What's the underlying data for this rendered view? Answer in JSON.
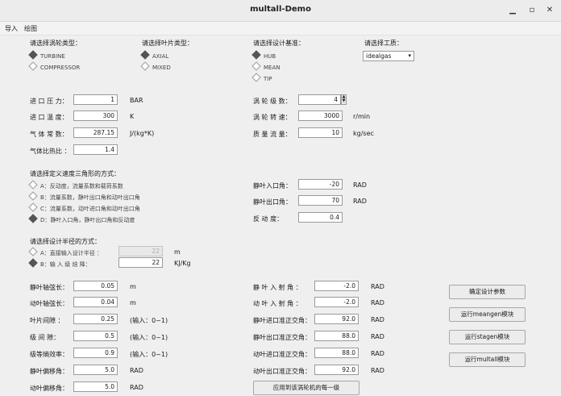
{
  "window": {
    "title": "multall-Demo",
    "minimize_icon": "minimize-icon",
    "maximize_icon": "maximize-icon",
    "close_icon": "close-icon"
  },
  "menu": {
    "import": "导入",
    "plot": "绘图"
  },
  "groups": {
    "turbine_type": {
      "label": "请选择涡轮类型：",
      "options": [
        "TURBINE",
        "COMPRESSOR"
      ],
      "selected": 0
    },
    "blade_type": {
      "label": "请选择叶片类型：",
      "options": [
        "AXIAL",
        "MIXED"
      ],
      "selected": 0
    },
    "design_basis": {
      "label": "请选择设计基准：",
      "options": [
        "HUB",
        "MEAN",
        "TIP"
      ],
      "selected": 0
    },
    "condition": {
      "label": "请选择工质：",
      "value": "idealgas"
    }
  },
  "params_left": [
    {
      "label": "进 口 压 力：",
      "value": "1",
      "unit": "BAR"
    },
    {
      "label": "进 口 温 度：",
      "value": "300",
      "unit": "K"
    },
    {
      "label": "气 体 常 数：",
      "value": "287.15",
      "unit": "J/(kg*K)"
    },
    {
      "label": "气体比热比 ：",
      "value": "1.4",
      "unit": ""
    }
  ],
  "params_right": [
    {
      "label": "涡 轮 级 数：",
      "value": "4",
      "unit": ""
    },
    {
      "label": "涡 轮 转 速：",
      "value": "3000",
      "unit": "r/min"
    },
    {
      "label": "质 量 流 量：",
      "value": "10",
      "unit": "kg/sec"
    }
  ],
  "velocity": {
    "label": "请选择定义速度三角形的方式：",
    "options": [
      "A：反动度，流量系数和载荷系数",
      "B：流量系数，静叶出口角和动叶出口角",
      "C：流量系数，动叶进口角和动叶出口角",
      "D：静叶入口角，静叶出口角和反动度"
    ],
    "selected": 3
  },
  "velocity_params": [
    {
      "label": "静叶入口角：",
      "value": "-20",
      "unit": "RAD"
    },
    {
      "label": "静叶出口角：",
      "value": "70",
      "unit": "RAD"
    },
    {
      "label": "反  动  度：",
      "value": "0.4",
      "unit": ""
    }
  ],
  "radius": {
    "label": "请选择设计半径的方式：",
    "options": [
      "A：直接输入设计半径 ：",
      "B：输  入  级  焓  降："
    ],
    "selected": 1,
    "values": [
      "22",
      "22"
    ],
    "units": [
      "m",
      "KJ/Kg"
    ]
  },
  "bottom_left": [
    {
      "label": "静叶轴弦长：",
      "value": "0.05",
      "unit": "m"
    },
    {
      "label": "动叶轴弦长：",
      "value": "0.04",
      "unit": "m"
    },
    {
      "label": "叶片间隙  ：",
      "value": "0.25",
      "unit": "(输入：0~1)"
    },
    {
      "label": "级  间  隙：",
      "value": "0.5",
      "unit": "(输入：0~1)"
    },
    {
      "label": "级等熵效率：",
      "value": "0.9",
      "unit": "(输入：0~1)"
    },
    {
      "label": "静叶偏移角：",
      "value": "5.0",
      "unit": "RAD"
    },
    {
      "label": "动叶偏移角：",
      "value": "5.0",
      "unit": "RAD"
    }
  ],
  "bottom_right": [
    {
      "label": "静 叶 入 射 角 ：",
      "value": "-2.0",
      "unit": "RAD"
    },
    {
      "label": "动 叶 入 射 角 ：",
      "value": "-2.0",
      "unit": "RAD"
    },
    {
      "label": "静叶进口准正交角：",
      "value": "92.0",
      "unit": "RAD"
    },
    {
      "label": "静叶出口准正交角：",
      "value": "88.0",
      "unit": "RAD"
    },
    {
      "label": "动叶进口准正交角：",
      "value": "88.0",
      "unit": "RAD"
    },
    {
      "label": "动叶出口准正交角：",
      "value": "92.0",
      "unit": "RAD"
    }
  ],
  "apply_button": "应用到该涡轮机的每一级",
  "buttons": [
    "确定设计参数",
    "运行meangen模块",
    "运行stagen模块",
    "运行multall模块"
  ]
}
